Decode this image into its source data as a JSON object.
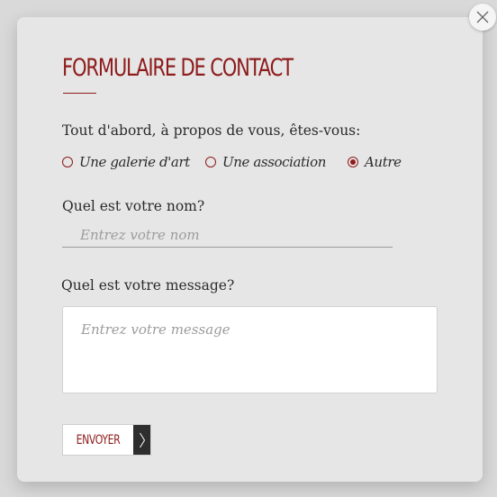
{
  "form": {
    "title": "FORMULAIRE DE CONTACT",
    "about_question": "Tout d'abord, à propos de vous, êtes-vous:",
    "options": [
      {
        "label": "Une galerie d'art",
        "selected": false
      },
      {
        "label": "Une association",
        "selected": false
      },
      {
        "label": "Autre",
        "selected": true
      }
    ],
    "name_question": "Quel est votre nom?",
    "name_placeholder": "Entrez votre nom",
    "name_value": "",
    "message_question": "Quel est votre message?",
    "message_placeholder": "Entrez votre message",
    "message_value": "",
    "submit_label": "ENVOYER"
  },
  "colors": {
    "accent": "#8e1b1b",
    "backdrop": "#d9d9d9",
    "panel": "#e6e6e6",
    "submit_arrow_bg": "#2e2e2e"
  },
  "icons": {
    "close": "close-icon",
    "submit_arrow": "chevron-right-icon"
  }
}
